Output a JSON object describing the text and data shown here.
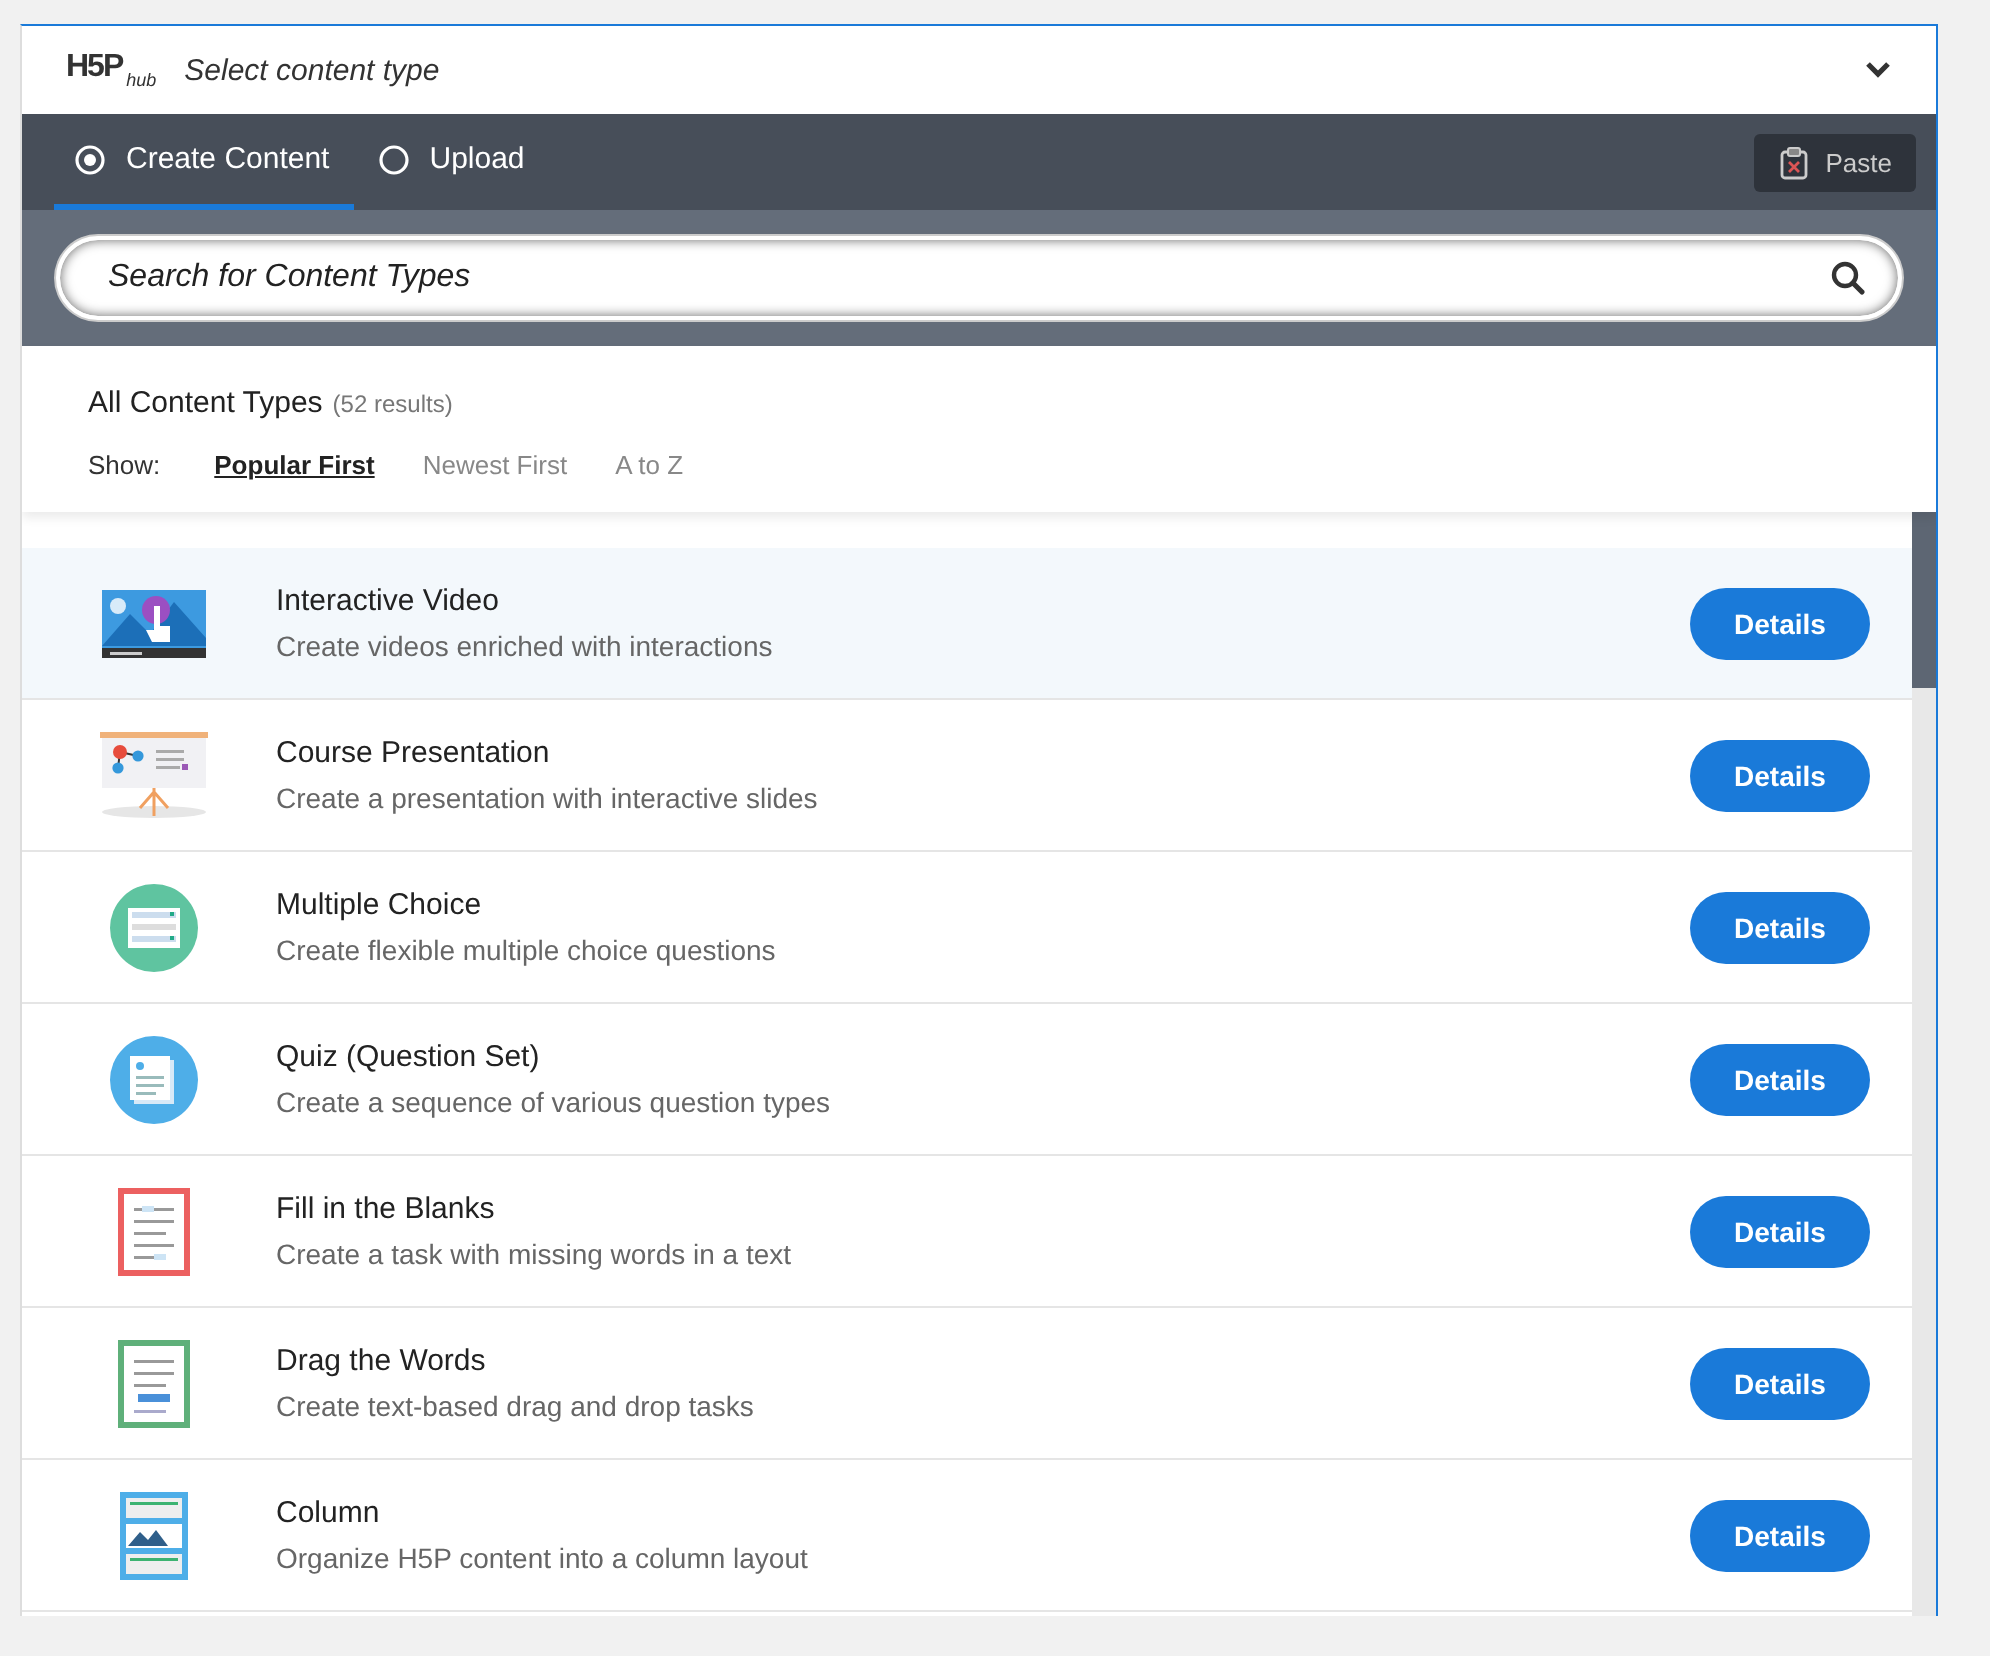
{
  "header": {
    "logo": "H5P",
    "logo_suffix": "hub",
    "title": "Select content type"
  },
  "tabs": [
    {
      "label": "Create Content",
      "selected": true
    },
    {
      "label": "Upload",
      "selected": false
    }
  ],
  "paste_button": "Paste",
  "search": {
    "placeholder": "Search for Content Types"
  },
  "results": {
    "heading": "All Content Types",
    "count": "(52 results)",
    "show_label": "Show:",
    "sort_options": [
      {
        "label": "Popular First",
        "selected": true
      },
      {
        "label": "Newest First",
        "selected": false
      },
      {
        "label": "A to Z",
        "selected": false
      }
    ]
  },
  "content_types": [
    {
      "kind": "video",
      "title": "Interactive Video",
      "description": "Create videos enriched with interactions",
      "button": "Details",
      "selected": true
    },
    {
      "kind": "presentation",
      "title": "Course Presentation",
      "description": "Create a presentation with interactive slides",
      "button": "Details",
      "selected": false
    },
    {
      "kind": "choice",
      "title": "Multiple Choice",
      "description": "Create flexible multiple choice questions",
      "button": "Details",
      "selected": false
    },
    {
      "kind": "quiz",
      "title": "Quiz (Question Set)",
      "description": "Create a sequence of various question types",
      "button": "Details",
      "selected": false
    },
    {
      "kind": "blanks",
      "title": "Fill in the Blanks",
      "description": "Create a task with missing words in a text",
      "button": "Details",
      "selected": false
    },
    {
      "kind": "drag",
      "title": "Drag the Words",
      "description": "Create text-based drag and drop tasks",
      "button": "Details",
      "selected": false
    },
    {
      "kind": "column",
      "title": "Column",
      "description": "Organize H5P content into a column layout",
      "button": "Details",
      "selected": false
    }
  ]
}
